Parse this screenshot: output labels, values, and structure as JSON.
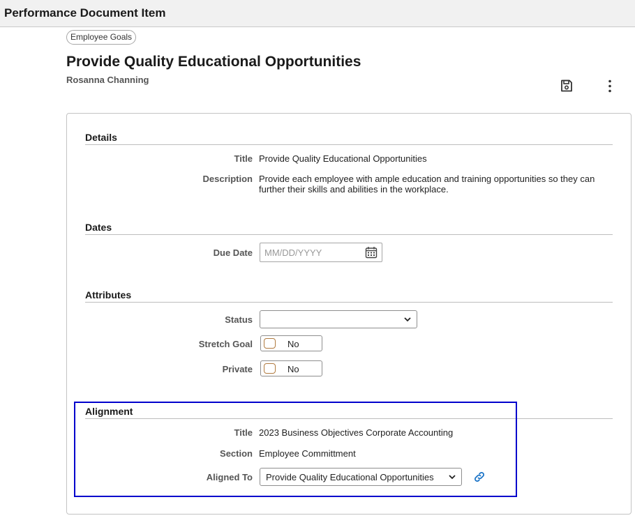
{
  "header": {
    "title": "Performance Document Item"
  },
  "breadcrumb": {
    "label": "Employee Goals"
  },
  "page": {
    "title": "Provide Quality Educational Opportunities",
    "subtitle": "Rosanna Channing"
  },
  "toolbar": {
    "save_icon": "save-icon",
    "more_icon": "more-vertical-icon"
  },
  "details": {
    "heading": "Details",
    "title_label": "Title",
    "title_value": "Provide Quality Educational Opportunities",
    "description_label": "Description",
    "description_value": "Provide each employee with ample education and training opportunities so they can further their skills and abilities in the workplace."
  },
  "dates": {
    "heading": "Dates",
    "due_date_label": "Due Date",
    "due_date_placeholder": "MM/DD/YYYY",
    "due_date_value": ""
  },
  "attributes": {
    "heading": "Attributes",
    "status_label": "Status",
    "status_value": "",
    "stretch_goal_label": "Stretch Goal",
    "stretch_goal_value": "No",
    "private_label": "Private",
    "private_value": "No"
  },
  "alignment": {
    "heading": "Alignment",
    "title_label": "Title",
    "title_value": "2023 Business Objectives Corporate Accounting",
    "section_label": "Section",
    "section_value": "Employee Committment",
    "aligned_to_label": "Aligned To",
    "aligned_to_value": "Provide Quality Educational Opportunities"
  },
  "colors": {
    "highlight": "#0000cc",
    "link_icon": "#1a73c7"
  }
}
